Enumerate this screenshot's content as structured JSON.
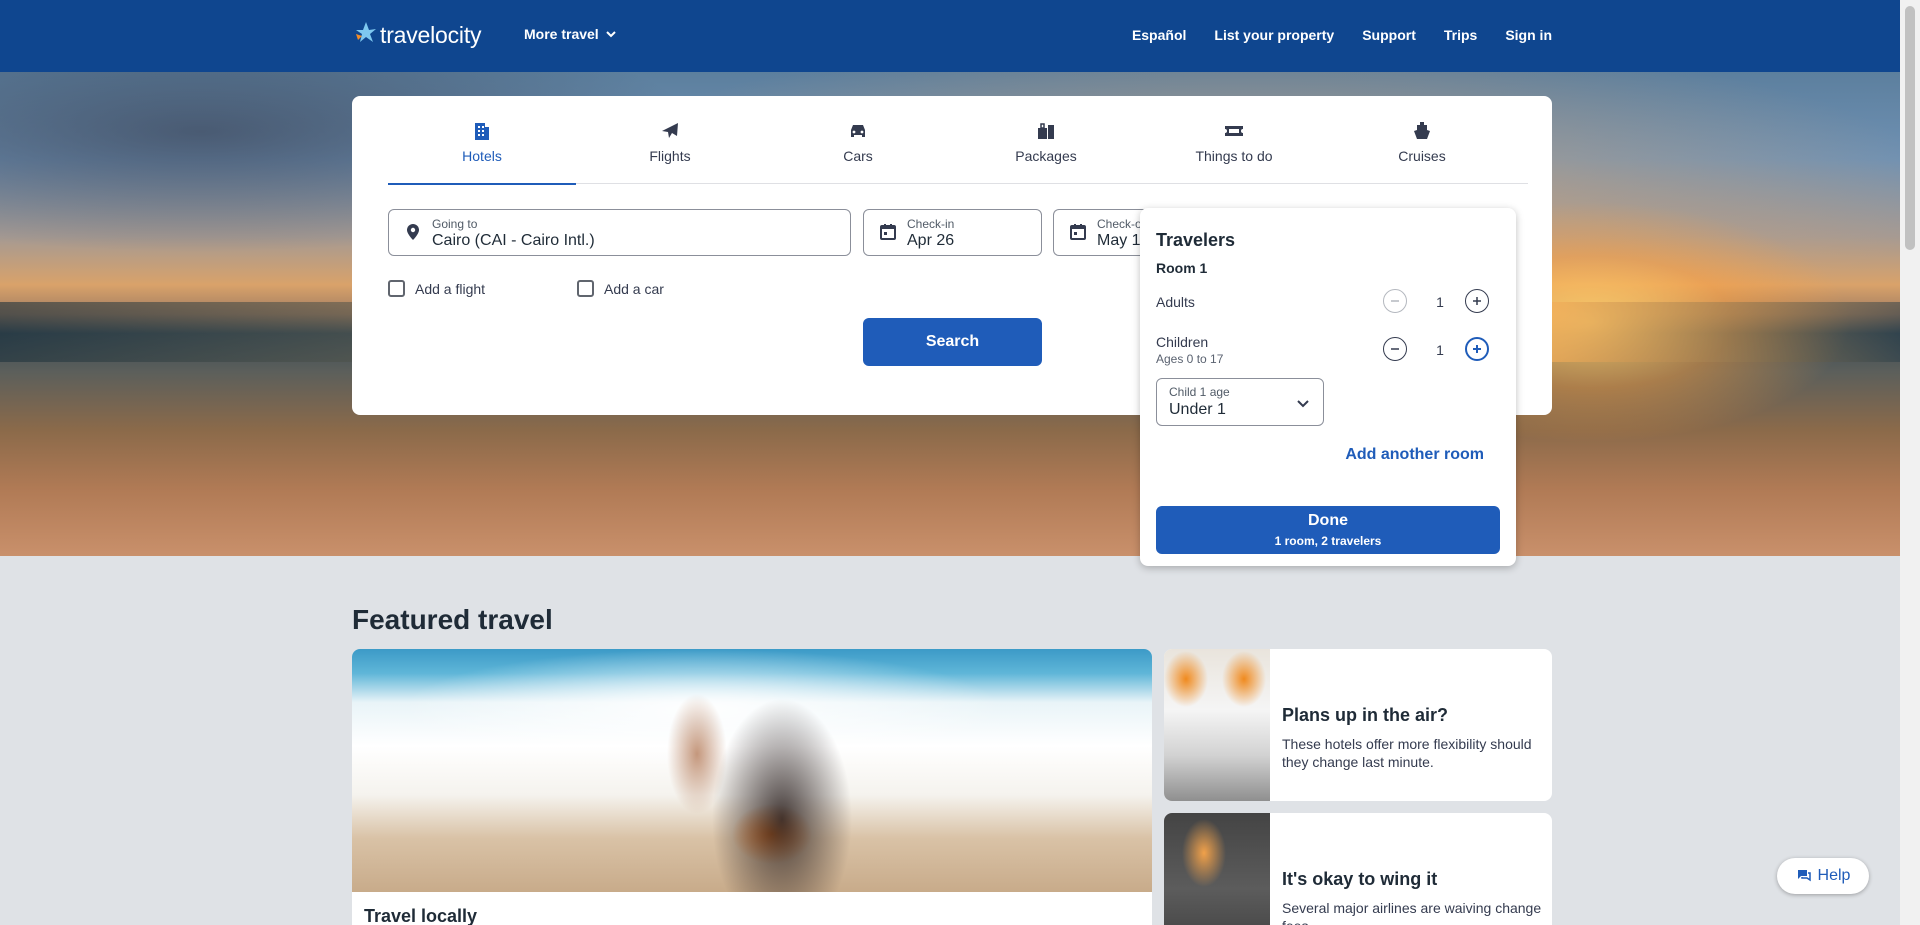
{
  "header": {
    "logo_text": "travelocity",
    "more_travel": "More travel",
    "nav": [
      "Español",
      "List your property",
      "Support",
      "Trips",
      "Sign in"
    ]
  },
  "tabs": [
    {
      "label": "Hotels",
      "icon": "hotel-icon",
      "active": true
    },
    {
      "label": "Flights",
      "icon": "plane-icon",
      "active": false
    },
    {
      "label": "Cars",
      "icon": "car-icon",
      "active": false
    },
    {
      "label": "Packages",
      "icon": "packages-icon",
      "active": false
    },
    {
      "label": "Things to do",
      "icon": "ticket-icon",
      "active": false
    },
    {
      "label": "Cruises",
      "icon": "ship-icon",
      "active": false
    }
  ],
  "search": {
    "going_to_label": "Going to",
    "going_to_value": "Cairo (CAI - Cairo Intl.)",
    "checkin_label": "Check-in",
    "checkin_value": "Apr 26",
    "checkout_label": "Check-o",
    "checkout_value": "May 1",
    "add_flight": "Add a flight",
    "add_car": "Add a car",
    "search_button": "Search"
  },
  "travelers": {
    "title": "Travelers",
    "room": "Room 1",
    "adults_label": "Adults",
    "adults_value": "1",
    "children_label": "Children",
    "children_sub": "Ages 0 to 17",
    "children_value": "1",
    "child_age_label": "Child 1 age",
    "child_age_value": "Under 1",
    "add_room": "Add another room",
    "done": "Done",
    "done_sub": "1 room, 2 travelers"
  },
  "featured": {
    "title": "Featured travel",
    "big_card_title": "Travel locally",
    "card1_title": "Plans up in the air?",
    "card1_text": "These hotels offer more flexibility should they change last minute.",
    "card2_title": "It's okay to wing it",
    "card2_text": "Several major airlines are waiving change fees"
  },
  "help": "Help",
  "colors": {
    "header": "#0f468f",
    "accent": "#1f5cb9"
  }
}
